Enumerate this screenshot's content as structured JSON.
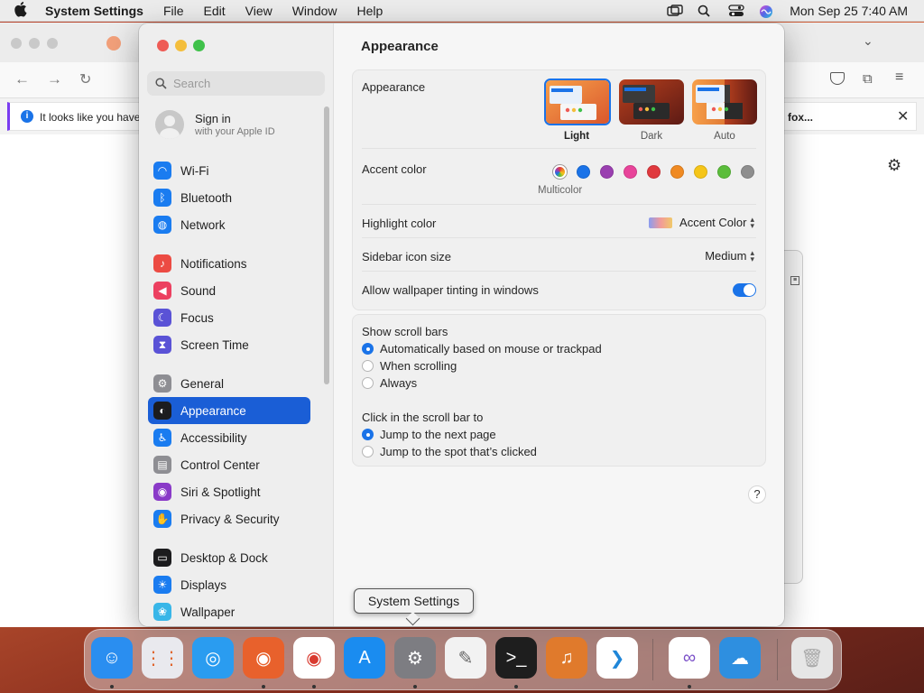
{
  "menubar": {
    "app_name": "System Settings",
    "menus": [
      "File",
      "Edit",
      "View",
      "Window",
      "Help"
    ],
    "clock": "Mon Sep 25  7:40 AM"
  },
  "browser": {
    "notice_text": "It looks like you haven",
    "notice_tail": "fox..."
  },
  "sidebar": {
    "search_placeholder": "Search",
    "signin_title": "Sign in",
    "signin_sub": "with your Apple ID",
    "items": [
      {
        "label": "Wi-Fi",
        "icon": "wifi-icon",
        "color": "#1a7cf0"
      },
      {
        "label": "Bluetooth",
        "icon": "bluetooth-icon",
        "color": "#1a7cf0"
      },
      {
        "label": "Network",
        "icon": "globe-icon",
        "color": "#1a7cf0"
      },
      {
        "label": "Notifications",
        "icon": "bell-icon",
        "color": "#ec4b43"
      },
      {
        "label": "Sound",
        "icon": "speaker-icon",
        "color": "#ec4060"
      },
      {
        "label": "Focus",
        "icon": "moon-icon",
        "color": "#5a52d6"
      },
      {
        "label": "Screen Time",
        "icon": "hourglass-icon",
        "color": "#5a52d6"
      },
      {
        "label": "General",
        "icon": "gear-icon",
        "color": "#8e8e93"
      },
      {
        "label": "Appearance",
        "icon": "appearance-icon",
        "color": "#1c1c1e"
      },
      {
        "label": "Accessibility",
        "icon": "accessibility-icon",
        "color": "#1a7cf0"
      },
      {
        "label": "Control Center",
        "icon": "control-center-icon",
        "color": "#8e8e93"
      },
      {
        "label": "Siri & Spotlight",
        "icon": "siri-icon",
        "color": "#8a3ac8"
      },
      {
        "label": "Privacy & Security",
        "icon": "hand-icon",
        "color": "#1a7cf0"
      },
      {
        "label": "Desktop & Dock",
        "icon": "dock-icon",
        "color": "#1c1c1e"
      },
      {
        "label": "Displays",
        "icon": "sun-icon",
        "color": "#1a7cf0"
      },
      {
        "label": "Wallpaper",
        "icon": "wallpaper-icon",
        "color": "#38b6e8"
      }
    ],
    "selected": "Appearance"
  },
  "main": {
    "title": "Appearance",
    "appearance_label": "Appearance",
    "modes": [
      "Light",
      "Dark",
      "Auto"
    ],
    "selected_mode": "Light",
    "accent_label": "Accent color",
    "accent_colors": [
      "multicolor",
      "#1a73e8",
      "#9a3fb0",
      "#e8449a",
      "#e0393e",
      "#f08a22",
      "#f5c518",
      "#5bbd3b",
      "#8e8e8e"
    ],
    "accent_caption": "Multicolor",
    "highlight_label": "Highlight color",
    "highlight_value": "Accent Color",
    "icon_size_label": "Sidebar icon size",
    "icon_size_value": "Medium",
    "tinting_label": "Allow wallpaper tinting in windows",
    "tinting_on": true,
    "scroll_label": "Show scroll bars",
    "scroll_options": [
      "Automatically based on mouse or trackpad",
      "When scrolling",
      "Always"
    ],
    "scroll_selected": 0,
    "click_label": "Click in the scroll bar to",
    "click_options": [
      "Jump to the next page",
      "Jump to the spot that’s clicked"
    ],
    "click_selected": 0,
    "help": "?"
  },
  "tooltip": "System Settings",
  "dock": {
    "apps": [
      {
        "name": "Finder",
        "icon": "finder-icon",
        "color": "#2a8ef0",
        "running": true
      },
      {
        "name": "Launchpad",
        "icon": "launchpad-icon",
        "color": "#e9e9ee",
        "running": false
      },
      {
        "name": "Safari",
        "icon": "safari-icon",
        "color": "#2a9cf0",
        "running": false
      },
      {
        "name": "Firefox",
        "icon": "firefox-icon",
        "color": "#e8612c",
        "running": true
      },
      {
        "name": "Chrome",
        "icon": "chrome-icon",
        "color": "#ffffff",
        "running": true
      },
      {
        "name": "App Store",
        "icon": "app-store-icon",
        "color": "#1a8cf0",
        "running": false
      },
      {
        "name": "System Settings",
        "icon": "gear-icon",
        "color": "#7d7d82",
        "running": true
      },
      {
        "name": "TextEdit",
        "icon": "textedit-icon",
        "color": "#f2f2f2",
        "running": false
      },
      {
        "name": "Terminal",
        "icon": "terminal-icon",
        "color": "#1e1e1e",
        "running": true
      },
      {
        "name": "GarageBand",
        "icon": "guitar-icon",
        "color": "#e07a2c",
        "running": false
      },
      {
        "name": "VS Code",
        "icon": "vscode-icon",
        "color": "#ffffff",
        "running": false
      },
      {
        "name": "Visual Studio",
        "icon": "visual-studio-icon",
        "color": "#ffffff",
        "running": true
      },
      {
        "name": "Weather",
        "icon": "weather-icon",
        "color": "#2e8fe0",
        "running": false
      },
      {
        "name": "Trash",
        "icon": "trash-icon",
        "color": "#e6e6e6",
        "running": false
      }
    ]
  }
}
